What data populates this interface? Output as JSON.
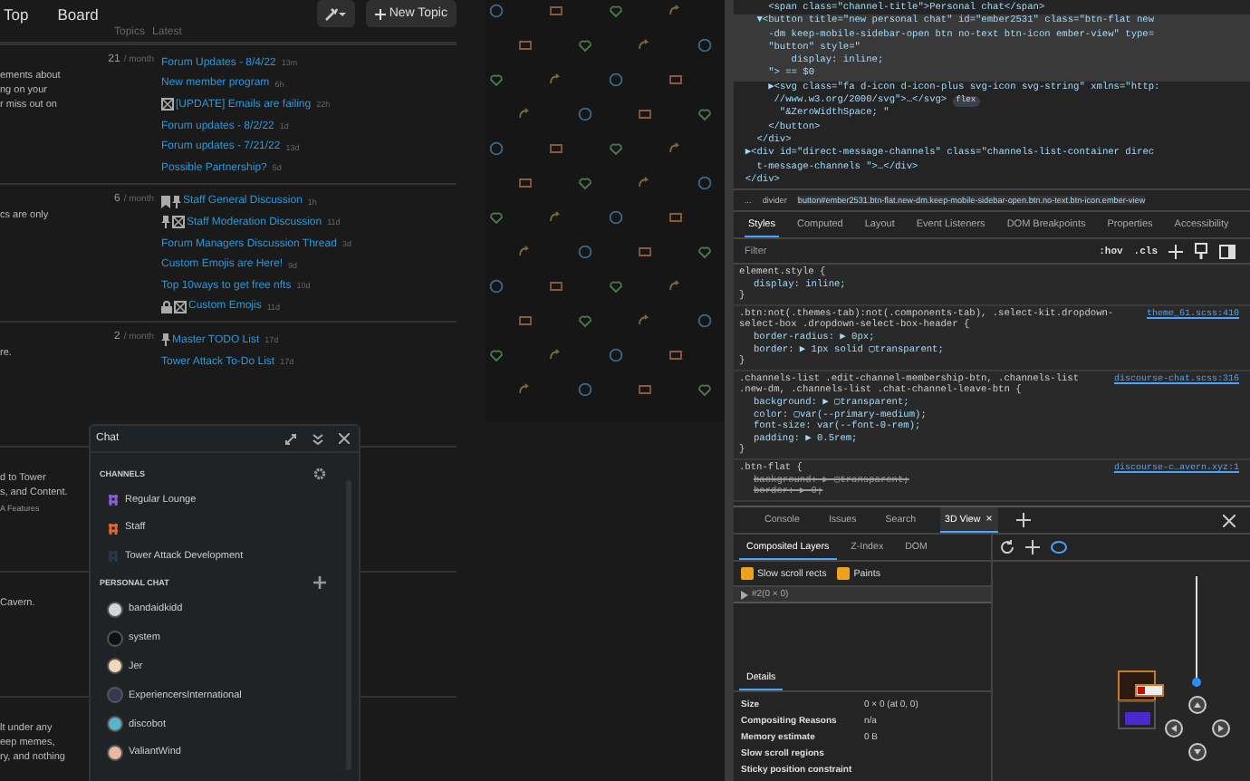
{
  "forum": {
    "nav": [
      "Top",
      "Board"
    ],
    "new_topic": "New Topic",
    "columns": [
      "Topics",
      "Latest"
    ],
    "categories": [
      {
        "lines": [
          "ements about",
          "ng on your",
          "r miss out on"
        ],
        "count": "21",
        "per": "/ month",
        "topics": [
          {
            "title": "Forum Updates - 8/4/22",
            "age": "13m",
            "bookmarked": false,
            "pinned": false,
            "locked": false,
            "closed": false
          },
          {
            "title": "New member program",
            "age": "6h",
            "bookmarked": false,
            "pinned": false,
            "locked": false,
            "closed": false
          },
          {
            "title": "[UPDATE] Emails are failing",
            "age": "22h",
            "bookmarked": false,
            "pinned": false,
            "locked": false,
            "closed": true
          },
          {
            "title": "Forum updates - 8/2/22",
            "age": "1d",
            "bookmarked": false,
            "pinned": false,
            "locked": false,
            "closed": false
          },
          {
            "title": "Forum updates - 7/21/22",
            "age": "13d",
            "bookmarked": false,
            "pinned": false,
            "locked": false,
            "closed": false
          },
          {
            "title": "Possible Partnership?",
            "age": "5d",
            "bookmarked": false,
            "pinned": false,
            "locked": false,
            "closed": false
          }
        ]
      },
      {
        "lines": [
          "cs are only"
        ],
        "count": "6",
        "per": "/ month",
        "topics": [
          {
            "title": "Staff General Discussion",
            "age": "1h",
            "bookmarked": true,
            "pinned": true,
            "locked": false,
            "closed": false
          },
          {
            "title": "Staff Moderation Discussion",
            "age": "11d",
            "bookmarked": false,
            "pinned": true,
            "locked": false,
            "closed": true
          },
          {
            "title": "Forum Managers Discussion Thread",
            "age": "3d",
            "bookmarked": false,
            "pinned": false,
            "locked": false,
            "closed": false
          },
          {
            "title": "Custom Emojis are Here!",
            "age": "9d",
            "bookmarked": false,
            "pinned": false,
            "locked": false,
            "closed": false
          },
          {
            "title": "Top 10ways to get free nfts",
            "age": "10d",
            "bookmarked": false,
            "pinned": false,
            "locked": false,
            "closed": false
          },
          {
            "title": "Custom Emojis",
            "age": "11d",
            "bookmarked": false,
            "pinned": false,
            "locked": true,
            "closed": true
          }
        ]
      },
      {
        "lines": [
          "re."
        ],
        "count": "2",
        "per": "/ month",
        "topics": [
          {
            "title": "Master TODO List",
            "age": "17d",
            "bookmarked": false,
            "pinned": true,
            "locked": false,
            "closed": false
          },
          {
            "title": "Tower Attack To-Do List",
            "age": "17d",
            "bookmarked": false,
            "pinned": false,
            "locked": false,
            "closed": false
          }
        ]
      },
      {
        "lines": [
          "d to Tower",
          "s, and Content."
        ],
        "sub": "A Features"
      },
      {
        "lines": [
          "Cavern."
        ]
      },
      {
        "lines": [
          "lt under any",
          "eep memes,",
          "ry, and nothing"
        ]
      }
    ]
  },
  "chat": {
    "title": "Chat",
    "channels_heading": "CHANNELS",
    "channels": [
      {
        "name": "Regular Lounge",
        "color": "#8a5cd6"
      },
      {
        "name": "Staff",
        "color": "#e0662e"
      },
      {
        "name": "Tower Attack Development",
        "color": "#2a3550"
      }
    ],
    "personal_heading": "PERSONAL CHAT",
    "users": [
      {
        "name": "bandaidkidd",
        "color": "#d6d6d6"
      },
      {
        "name": "system",
        "color": "#111111"
      },
      {
        "name": "Jer",
        "color": "#f0d8b8"
      },
      {
        "name": "ExperiencersInternational",
        "color": "#3a3550"
      },
      {
        "name": "discobot",
        "color": "#5ab4c8"
      },
      {
        "name": "ValiantWind",
        "color": "#e8b8a0"
      }
    ]
  },
  "devtools": {
    "dom_lines": [
      {
        "text": "      <span class=\"channel-title\">Personal chat</span>",
        "selected": false
      },
      {
        "text": "    ▼<button title=\"new personal chat\" id=\"ember2531\" class=\"btn-flat new",
        "selected": true
      },
      {
        "text": "      -dm keep-mobile-sidebar-open btn no-text btn-icon ember-view\" type=",
        "selected": true
      },
      {
        "text": "      \"button\" style=\"",
        "selected": true
      },
      {
        "text": "          display: inline;",
        "selected": true
      },
      {
        "text": "      \"> == $0",
        "selected": true
      },
      {
        "text": "      ▶<svg class=\"fa d-icon d-icon-plus svg-icon svg-string\" xmlns=\"http:",
        "selected": false
      },
      {
        "text": "       //www.w3.org/2000/svg\">…</svg>",
        "badge": "flex",
        "selected": false
      },
      {
        "text": "        \"&ZeroWidthSpace; \"",
        "selected": false
      },
      {
        "text": "      </button>",
        "selected": false
      },
      {
        "text": "    </div>",
        "selected": false
      },
      {
        "text": "  ▶<div id=\"direct-message-channels\" class=\"channels-list-container direc",
        "selected": false
      },
      {
        "text": "    t-message-channels \">…</div>",
        "selected": false
      },
      {
        "text": "  </div>",
        "selected": false
      }
    ],
    "breadcrumbs": [
      "...",
      "divider",
      "button#ember2531.btn-flat.new-dm.keep-mobile-sidebar-open.btn.no-text.btn-icon.ember-view"
    ],
    "tabs": [
      {
        "label": "Styles",
        "selected": true
      },
      {
        "label": "Computed",
        "selected": false
      },
      {
        "label": "Layout",
        "selected": false
      },
      {
        "label": "Event Listeners",
        "selected": false
      },
      {
        "label": "DOM Breakpoints",
        "selected": false
      },
      {
        "label": "Properties",
        "selected": false
      },
      {
        "label": "Accessibility",
        "selected": false
      }
    ],
    "filter": {
      "placeholder": "Filter"
    },
    "hov": ":hov",
    "cls": ".cls",
    "rules": [
      {
        "selector": "element.style {",
        "props": [
          {
            "text": "display: inline;",
            "overridden": false
          }
        ],
        "end": "}"
      },
      {
        "selector": ".btn:not(.themes-tab):not(.components-tab), .select-kit.dropdown-select-box .dropdown-select-box-header {",
        "source": "theme_61.scss:410",
        "props": [
          {
            "text": "border-radius: ▶ 0px;",
            "overridden": false
          },
          {
            "text": "border: ▶ 1px solid ▢transparent;",
            "overridden": false
          }
        ],
        "end": "}"
      },
      {
        "selector": ".channels-list .edit-channel-membership-btn, .channels-list .new-dm, .channels-list .chat-channel-leave-btn {",
        "source": "discourse-chat.scss:316",
        "props": [
          {
            "text": "background: ▶ ▢transparent;",
            "overridden": false
          },
          {
            "text": "color: ▢var(--primary-medium);",
            "overridden": false
          },
          {
            "text": "font-size: var(--font-0-rem);",
            "overridden": false
          },
          {
            "text": "padding: ▶ 0.5rem;",
            "overridden": false
          }
        ],
        "end": "}"
      },
      {
        "selector": ".btn-flat {",
        "source": "discourse-c…avern.xyz:1",
        "props": [
          {
            "text": "background: ▶ ▢transparent;",
            "overridden": true
          },
          {
            "text": "border: ▶ 0;",
            "overridden": true
          }
        ]
      }
    ],
    "drawer_tabs": [
      {
        "label": "Console",
        "selected": false
      },
      {
        "label": "Issues",
        "selected": false
      },
      {
        "label": "Search",
        "selected": false
      },
      {
        "label": "3D View",
        "selected": true
      }
    ],
    "close_tab": "×",
    "layer_tabs": [
      {
        "label": "Composited Layers",
        "selected": true
      },
      {
        "label": "Z-Index",
        "selected": false
      },
      {
        "label": "DOM",
        "selected": false
      }
    ],
    "checks": [
      {
        "label": "Slow scroll rects",
        "checked": true
      },
      {
        "label": "Paints",
        "checked": true
      }
    ],
    "tree_row": "#2(0 × 0)",
    "details_tab": "Details",
    "details": [
      {
        "key": "Size",
        "value": "0 × 0 (at 0, 0)"
      },
      {
        "key": "Compositing Reasons",
        "value": "n/a"
      },
      {
        "key": "Memory estimate",
        "value": "0 B"
      },
      {
        "key": "Slow scroll regions"
      },
      {
        "key": "Sticky position constraint"
      }
    ],
    "zoom": {
      "level": 0.0
    }
  }
}
